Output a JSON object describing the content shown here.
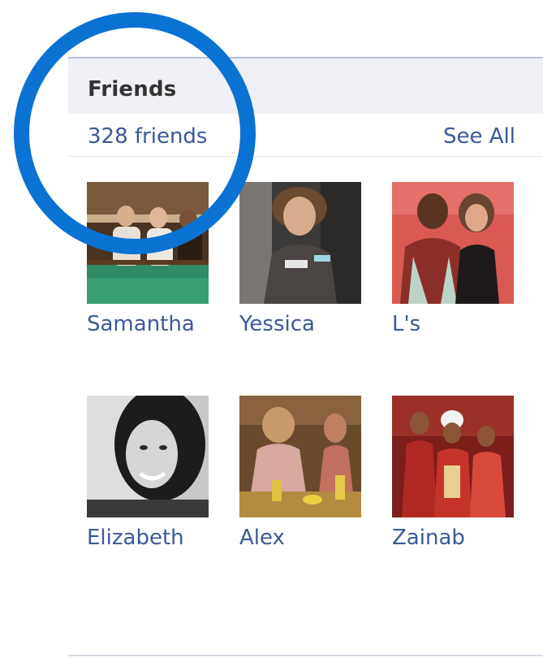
{
  "friends_box": {
    "title": "Friends",
    "count_label": "328 friends",
    "see_all_label": "See All",
    "friends": [
      {
        "name": "Samantha"
      },
      {
        "name": "Yessica"
      },
      {
        "name": "L's"
      },
      {
        "name": "Elizabeth"
      },
      {
        "name": "Alex"
      },
      {
        "name": "Zainab"
      }
    ]
  },
  "annotation": {
    "color": "#0a72d2"
  },
  "colors": {
    "link": "#3b5998",
    "header_bg": "#eff1f6",
    "header_border": "#b8c2d9"
  }
}
